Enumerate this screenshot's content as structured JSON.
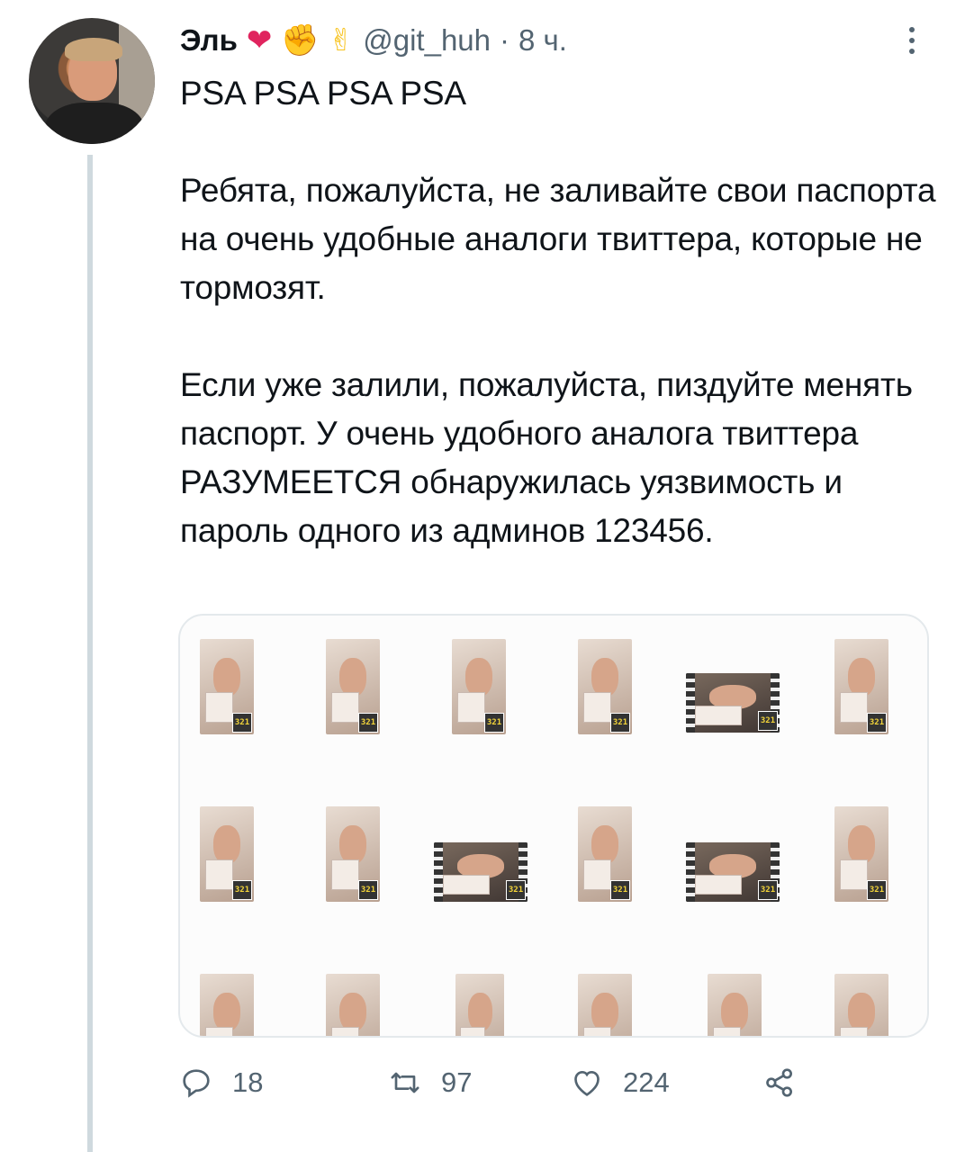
{
  "author": {
    "name": "Эль",
    "emojis": [
      "❤",
      "✊",
      "✌"
    ],
    "handle": "@git_huh",
    "separator": "·",
    "time": "8 ч."
  },
  "tweet": {
    "paragraphs": [
      "PSA PSA PSA PSA",
      "",
      "Ребята, пожалуйста, не заливайте свои паспорта на очень удобные аналоги твиттера, которые не тормозят.",
      "",
      "Если уже залили, пожалуйста, пиздуйте менять паспорт. У очень удобного аналога твиттера РАЗУМЕЕТСЯ обнаружилась уязвимость и пароль одного из админов 123456."
    ]
  },
  "media": {
    "badge_text": "321"
  },
  "actions": {
    "replies": "18",
    "retweets": "97",
    "likes": "224"
  },
  "colors": {
    "secondary": "#536471",
    "thread_line": "#cfd9de",
    "heart": "#e0245e"
  }
}
